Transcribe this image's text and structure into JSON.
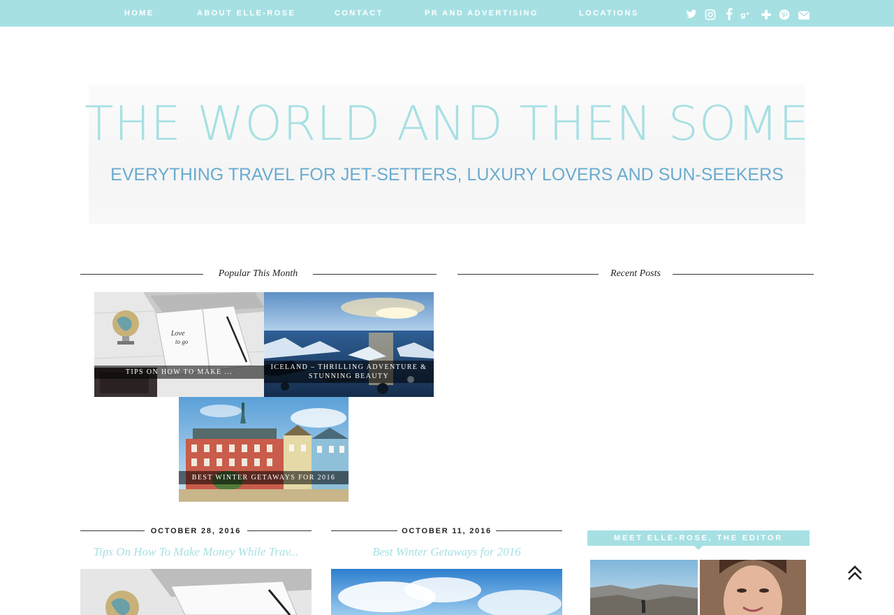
{
  "nav": {
    "items": [
      "HOME",
      "ABOUT ELLE-ROSE",
      "CONTACT",
      "PR AND ADVERTISING",
      "LOCATIONS"
    ],
    "social_icons": [
      "twitter-icon",
      "instagram-icon",
      "facebook-icon",
      "google-plus-icon",
      "bloglovin-icon",
      "pinterest-icon",
      "email-icon"
    ],
    "social_glyphs": [
      "𝕥",
      "◘",
      "f",
      "g+",
      "✚",
      "ⓟ",
      "✉"
    ]
  },
  "header": {
    "title": "THE WORLD AND THEN SOME",
    "tagline": "EVERYTHING TRAVEL FOR JET-SETTERS, LUXURY LOVERS AND SUN-SEEKERS"
  },
  "popular": {
    "heading": "Popular This Month",
    "tiles": [
      {
        "caption": "TIPS ON HOW TO MAKE ..."
      },
      {
        "caption": "ICELAND – THRILLING ADVENTURE & STUNNING BEAUTY"
      },
      {
        "caption": "BEST WINTER GETAWAYS FOR 2016"
      }
    ]
  },
  "recent": {
    "heading": "Recent Posts"
  },
  "posts": [
    {
      "date": "OCTOBER 28, 2016",
      "title": "Tips On How To Make Money While Trav..."
    },
    {
      "date": "OCTOBER 11, 2016",
      "title": "Best Winter Getaways for 2016"
    }
  ],
  "sidebar": {
    "meet_heading": "MEET ELLE-ROSE, THE EDITOR"
  },
  "colors": {
    "accent": "#a6e0e3",
    "tagline": "#6aabcf"
  }
}
